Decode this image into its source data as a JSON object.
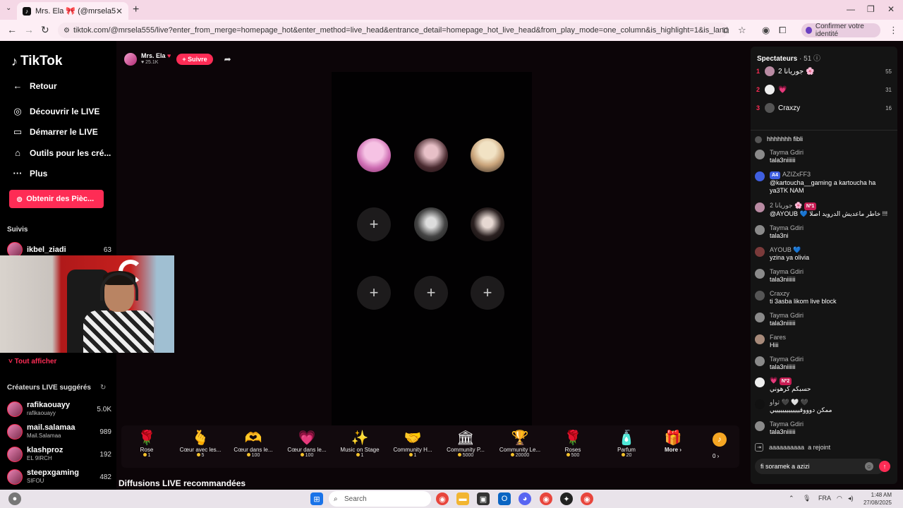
{
  "browser": {
    "tab_title": "Mrs. Ela 🎀 (@mrsela555) |",
    "url": "tiktok.com/@mrsela555/live?enter_from_merge=homepage_hot&enter_method=live_head&entrance_detail=homepage_hot_live_head&from_play_mode=one_column&is_highlight=1&is_landscape=0&request_id=20250...",
    "profile_label": "Confirmer votre identité"
  },
  "sidebar": {
    "logo": "TikTok",
    "back": "Retour",
    "items": [
      {
        "label": "Découvrir le LIVE",
        "icon": "live-discover-icon"
      },
      {
        "label": "Démarrer le LIVE",
        "icon": "camera-icon"
      },
      {
        "label": "Outils pour les cré...",
        "icon": "home-icon"
      },
      {
        "label": "Plus",
        "icon": "more-icon"
      }
    ],
    "coins_button": "Obtenir des Pièc...",
    "followed_label": "Suivis",
    "followed": [
      {
        "name": "ikbel_ziadi",
        "count": "63"
      }
    ],
    "show_all": "Tout afficher",
    "suggested_label": "Créateurs LIVE suggérés",
    "suggested": [
      {
        "name": "rafikaouayy",
        "sub": "rafikaouayy",
        "count": "5.0K"
      },
      {
        "name": "mail.salamaa",
        "sub": "Mail.Salamaa",
        "count": "989"
      },
      {
        "name": "klashproz",
        "sub": "EL 9IRCH",
        "count": "192"
      },
      {
        "name": "steepxgaming",
        "sub": "SIFOU",
        "count": "482"
      }
    ]
  },
  "host": {
    "name": "Mrs. Ela",
    "likes": "25.1K",
    "follow_label": "+ Suivre"
  },
  "gifts": [
    {
      "name": "Rose",
      "price": "1",
      "icon": "🌹"
    },
    {
      "name": "Cœur avec les...",
      "price": "5",
      "icon": "🫰"
    },
    {
      "name": "Cœur dans le...",
      "price": "100",
      "icon": "🫶"
    },
    {
      "name": "Cœur dans le...",
      "price": "100",
      "icon": "💗"
    },
    {
      "name": "Music on Stage",
      "price": "1",
      "icon": "✨"
    },
    {
      "name": "Community H...",
      "price": "1",
      "icon": "🤝"
    },
    {
      "name": "Community P...",
      "price": "5000",
      "icon": "🏛"
    },
    {
      "name": "Community Le...",
      "price": "20000",
      "icon": "🏆"
    },
    {
      "name": "Roses",
      "price": "500",
      "icon": "🌹"
    },
    {
      "name": "Parfum",
      "price": "20",
      "icon": "🧴"
    },
    {
      "name": "More",
      "price": "",
      "icon": "🎁"
    }
  ],
  "coin_balance": "0",
  "recommended_label": "Diffusions LIVE recommandées",
  "spectators": {
    "title": "Spectateurs",
    "count": "51",
    "top": [
      {
        "rank": "1",
        "name": "2 جوريانا 🌸",
        "score": "55"
      },
      {
        "rank": "2",
        "name": "💗",
        "score": "31"
      },
      {
        "rank": "3",
        "name": "Craxzy",
        "score": "16"
      }
    ]
  },
  "chat": [
    {
      "user": "",
      "msg": "hhhhhhh fibli"
    },
    {
      "user": "Tayma Gdiri",
      "msg": "tala3niiiiii"
    },
    {
      "user": "AZIZxFF3",
      "badge": "A4",
      "msg": "@kartoucha__gaming a kartoucha ha ya3TK NAM"
    },
    {
      "user": "2 جوريانا 🌸",
      "badge": "Nº1",
      "msg": "@AYOUB 💙 خاطر ماعديش الدرويد اصلا !!!"
    },
    {
      "user": "Tayma Gdiri",
      "msg": "tala3ni"
    },
    {
      "user": "AYOUB 💙",
      "msg": "yzina ya olivia"
    },
    {
      "user": "Tayma Gdiri",
      "msg": "tala3niiiiii"
    },
    {
      "user": "Craxzy",
      "msg": "ti 3asba likom live block"
    },
    {
      "user": "Tayma Gdiri",
      "msg": "tala3niiiiii"
    },
    {
      "user": "Fares",
      "msg": "Hiii"
    },
    {
      "user": "Tayma Gdiri",
      "msg": "tala3niiiiii"
    },
    {
      "user": "💗",
      "badge": "Nº2",
      "msg": "حسبكم كرهوني"
    },
    {
      "user": "ثواو 🖤 🤍 🖤",
      "msg": "ممكن دوووقيييييييييييييي"
    },
    {
      "user": "Tayma Gdiri",
      "msg": "tala3niiiiii"
    }
  ],
  "joined": {
    "user": "aaaaaaaaaa",
    "text": "a rejoint"
  },
  "chat_input_value": "fi soramek a azizi",
  "taskbar": {
    "search": "Search",
    "lang": "FRA",
    "time": "1:48 AM",
    "date": "27/08/2025"
  }
}
